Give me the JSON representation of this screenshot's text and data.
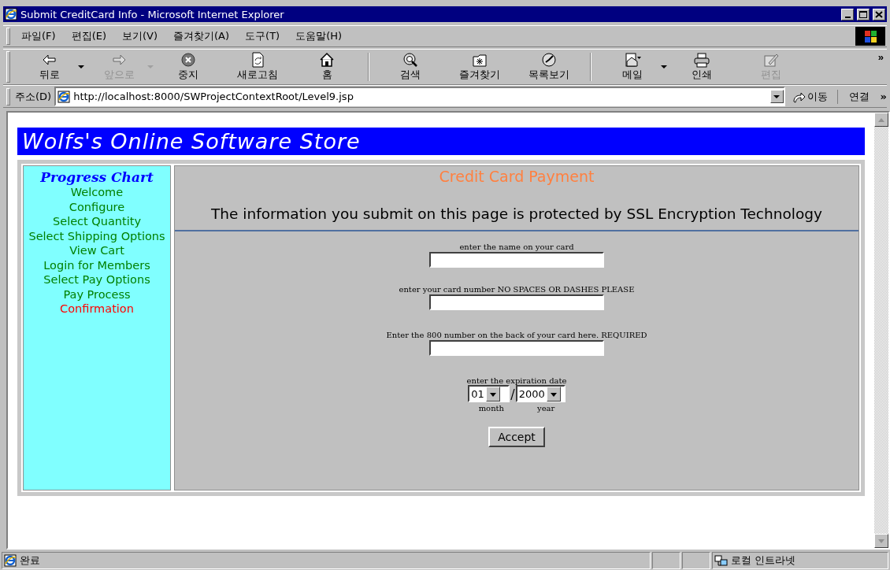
{
  "window": {
    "title": "Submit CreditCard Info - Microsoft Internet Explorer"
  },
  "menu": [
    {
      "label": "파일(F)"
    },
    {
      "label": "편집(E)"
    },
    {
      "label": "보기(V)"
    },
    {
      "label": "즐겨찾기(A)"
    },
    {
      "label": "도구(T)"
    },
    {
      "label": "도움말(H)"
    }
  ],
  "toolbar": {
    "groups": [
      [
        {
          "label": "뒤로",
          "disabled": false,
          "dropdown": true
        },
        {
          "label": "앞으로",
          "disabled": true,
          "dropdown": true
        },
        {
          "label": "중지",
          "disabled": false,
          "dropdown": false
        },
        {
          "label": "새로고침",
          "disabled": false,
          "dropdown": false
        },
        {
          "label": "홈",
          "disabled": false,
          "dropdown": false
        }
      ],
      [
        {
          "label": "검색",
          "disabled": false,
          "dropdown": false
        },
        {
          "label": "즐겨찾기",
          "disabled": false,
          "dropdown": false
        },
        {
          "label": "목록보기",
          "disabled": false,
          "dropdown": false
        }
      ],
      [
        {
          "label": "메일",
          "disabled": false,
          "dropdown": true
        },
        {
          "label": "인쇄",
          "disabled": false,
          "dropdown": false
        },
        {
          "label": "편집",
          "disabled": true,
          "dropdown": false
        }
      ]
    ],
    "more": "»"
  },
  "address_bar": {
    "label": "주소(D)",
    "url": "http://localhost:8000/SWProjectContextRoot/Level9.jsp",
    "go": "이동",
    "links": "연결",
    "links_more": "»"
  },
  "page": {
    "banner": "Wolfs's Online Software Store",
    "progress_chart": {
      "title": "Progress Chart",
      "steps": [
        {
          "label": "Welcome",
          "current": false
        },
        {
          "label": "Configure",
          "current": false
        },
        {
          "label": "Select Quantity",
          "current": false
        },
        {
          "label": "Select Shipping Options",
          "current": false
        },
        {
          "label": "View Cart",
          "current": false
        },
        {
          "label": "Login for Members",
          "current": false
        },
        {
          "label": "Select Pay Options",
          "current": false
        },
        {
          "label": "Pay Process",
          "current": false
        },
        {
          "label": "Confirmation",
          "current": true
        }
      ]
    },
    "payment": {
      "title": "Credit Card Payment",
      "notice": "The information you submit on this page is protected by SSL Encryption Technology",
      "fields": [
        {
          "label": "enter the name on your card"
        },
        {
          "label": "enter your card number NO SPACES OR DASHES PLEASE"
        },
        {
          "label": "Enter the 800 number on the back of your card here. REQUIRED"
        }
      ],
      "expiration": {
        "label": "enter the expiration date",
        "month": "01",
        "separator": "/",
        "year": "2000",
        "month_label": "month",
        "year_label": "year"
      },
      "button": "Accept"
    }
  },
  "status_bar": {
    "text": "완료",
    "zone": "로컬 인트라넷"
  }
}
